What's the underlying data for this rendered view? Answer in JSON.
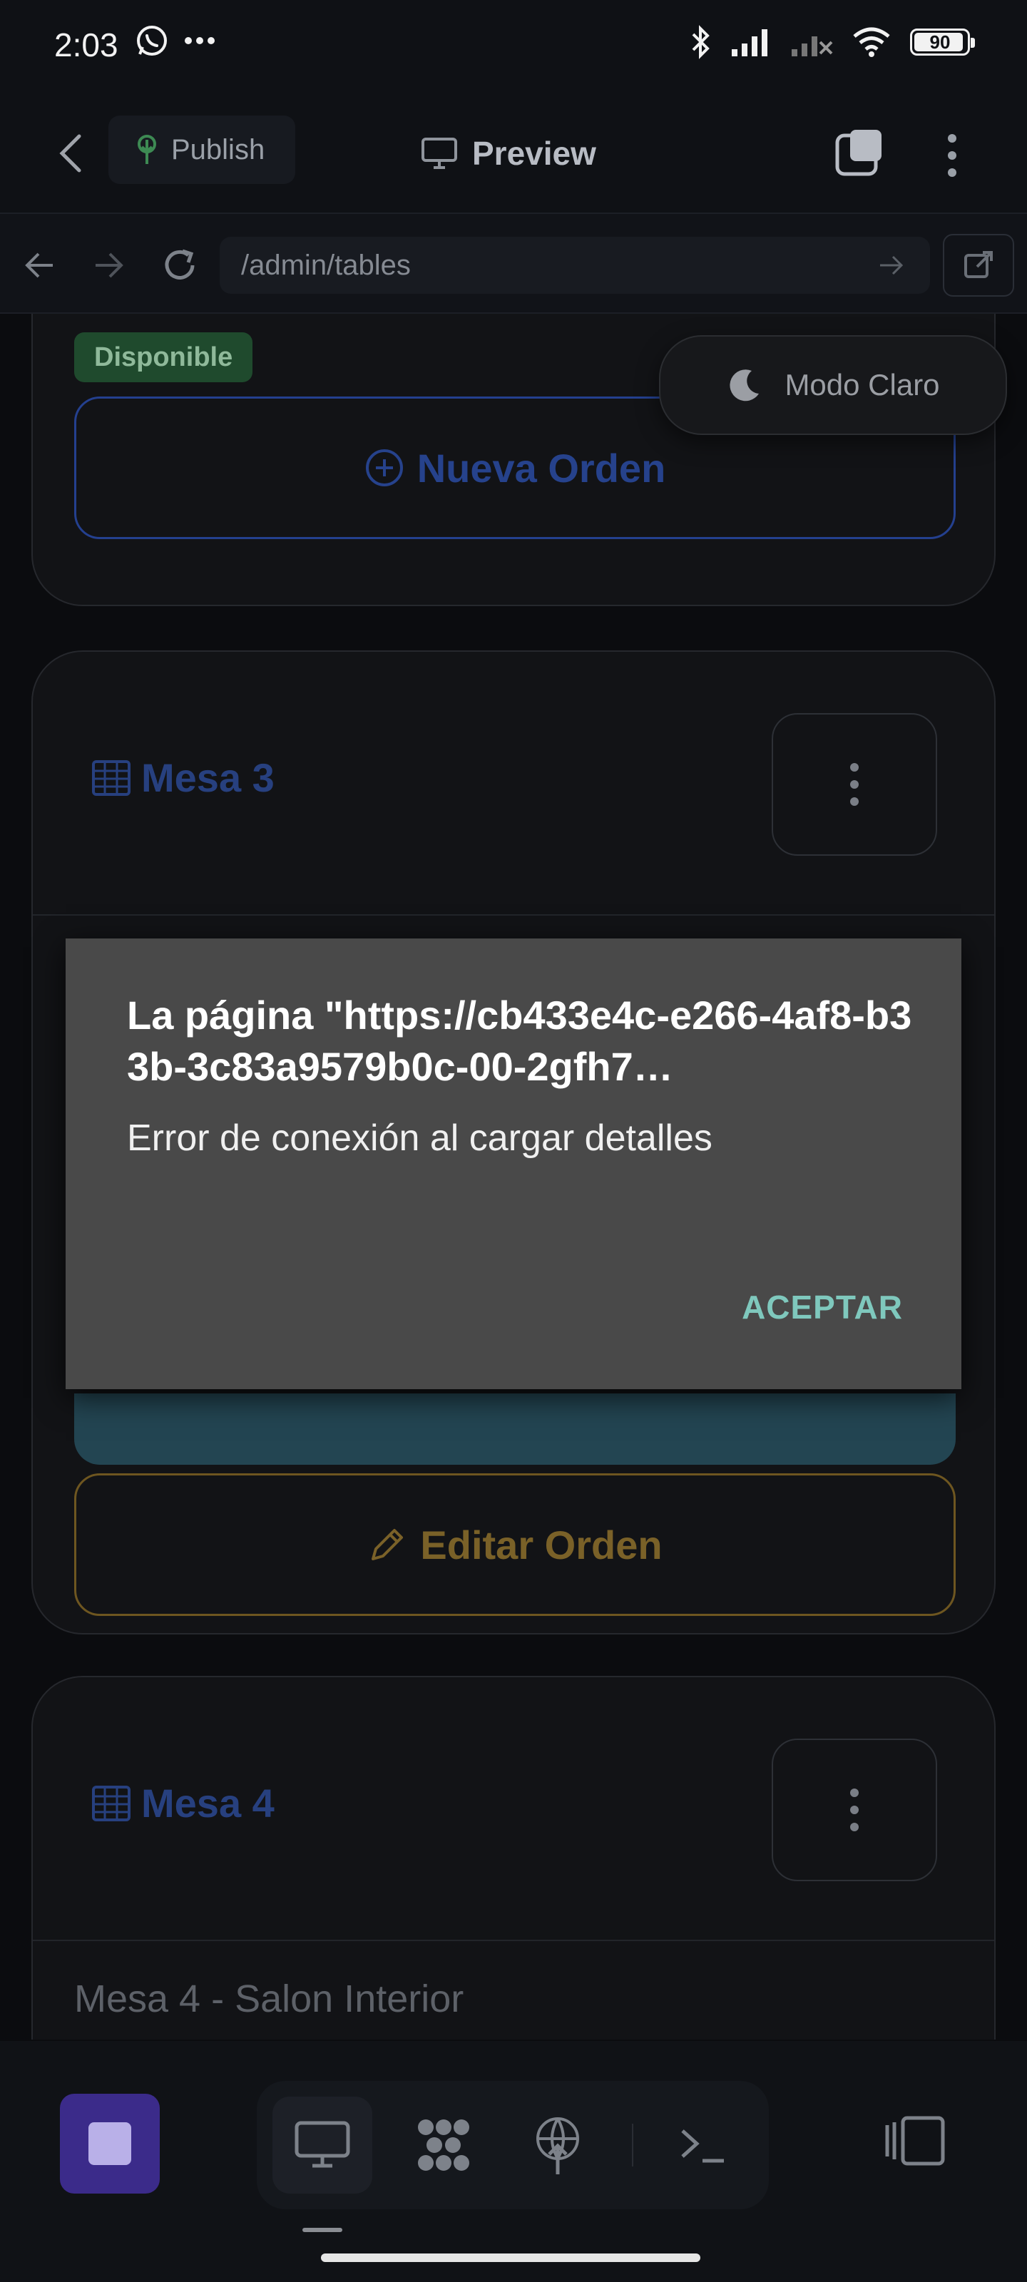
{
  "status_bar": {
    "time": "2:03",
    "battery": "90",
    "icons": [
      "whatsapp-icon",
      "more-icon",
      "bluetooth-icon",
      "signal-icon",
      "signal-off-icon",
      "wifi-icon",
      "battery-icon"
    ]
  },
  "app_bar": {
    "publish_label": "Publish",
    "preview_label": "Preview"
  },
  "url_bar": {
    "url": "/admin/tables"
  },
  "mode_toggle": {
    "label": "Modo Claro"
  },
  "cards": [
    {
      "badge": "Disponible",
      "primary_button": "Nueva Orden"
    },
    {
      "title": "Mesa 3",
      "secondary_button": "Editar Orden"
    },
    {
      "title": "Mesa 4",
      "subtitle": "Mesa 4 - Salon Interior"
    }
  ],
  "dialog": {
    "title": "La página \"https://cb433e4c-e266-4af8-b33b-3c83a9579b0c-00-2gfh7…",
    "message": "Error de conexión al cargar detalles",
    "ok_label": "ACEPTAR"
  },
  "colors": {
    "accent_blue": "#27407f",
    "accent_gold": "#7a6128",
    "badge_green": "#1f4a2d",
    "dialog_bg": "#494949",
    "dialog_button": "#7fc8bd",
    "stop_button": "#3b2b8a"
  }
}
